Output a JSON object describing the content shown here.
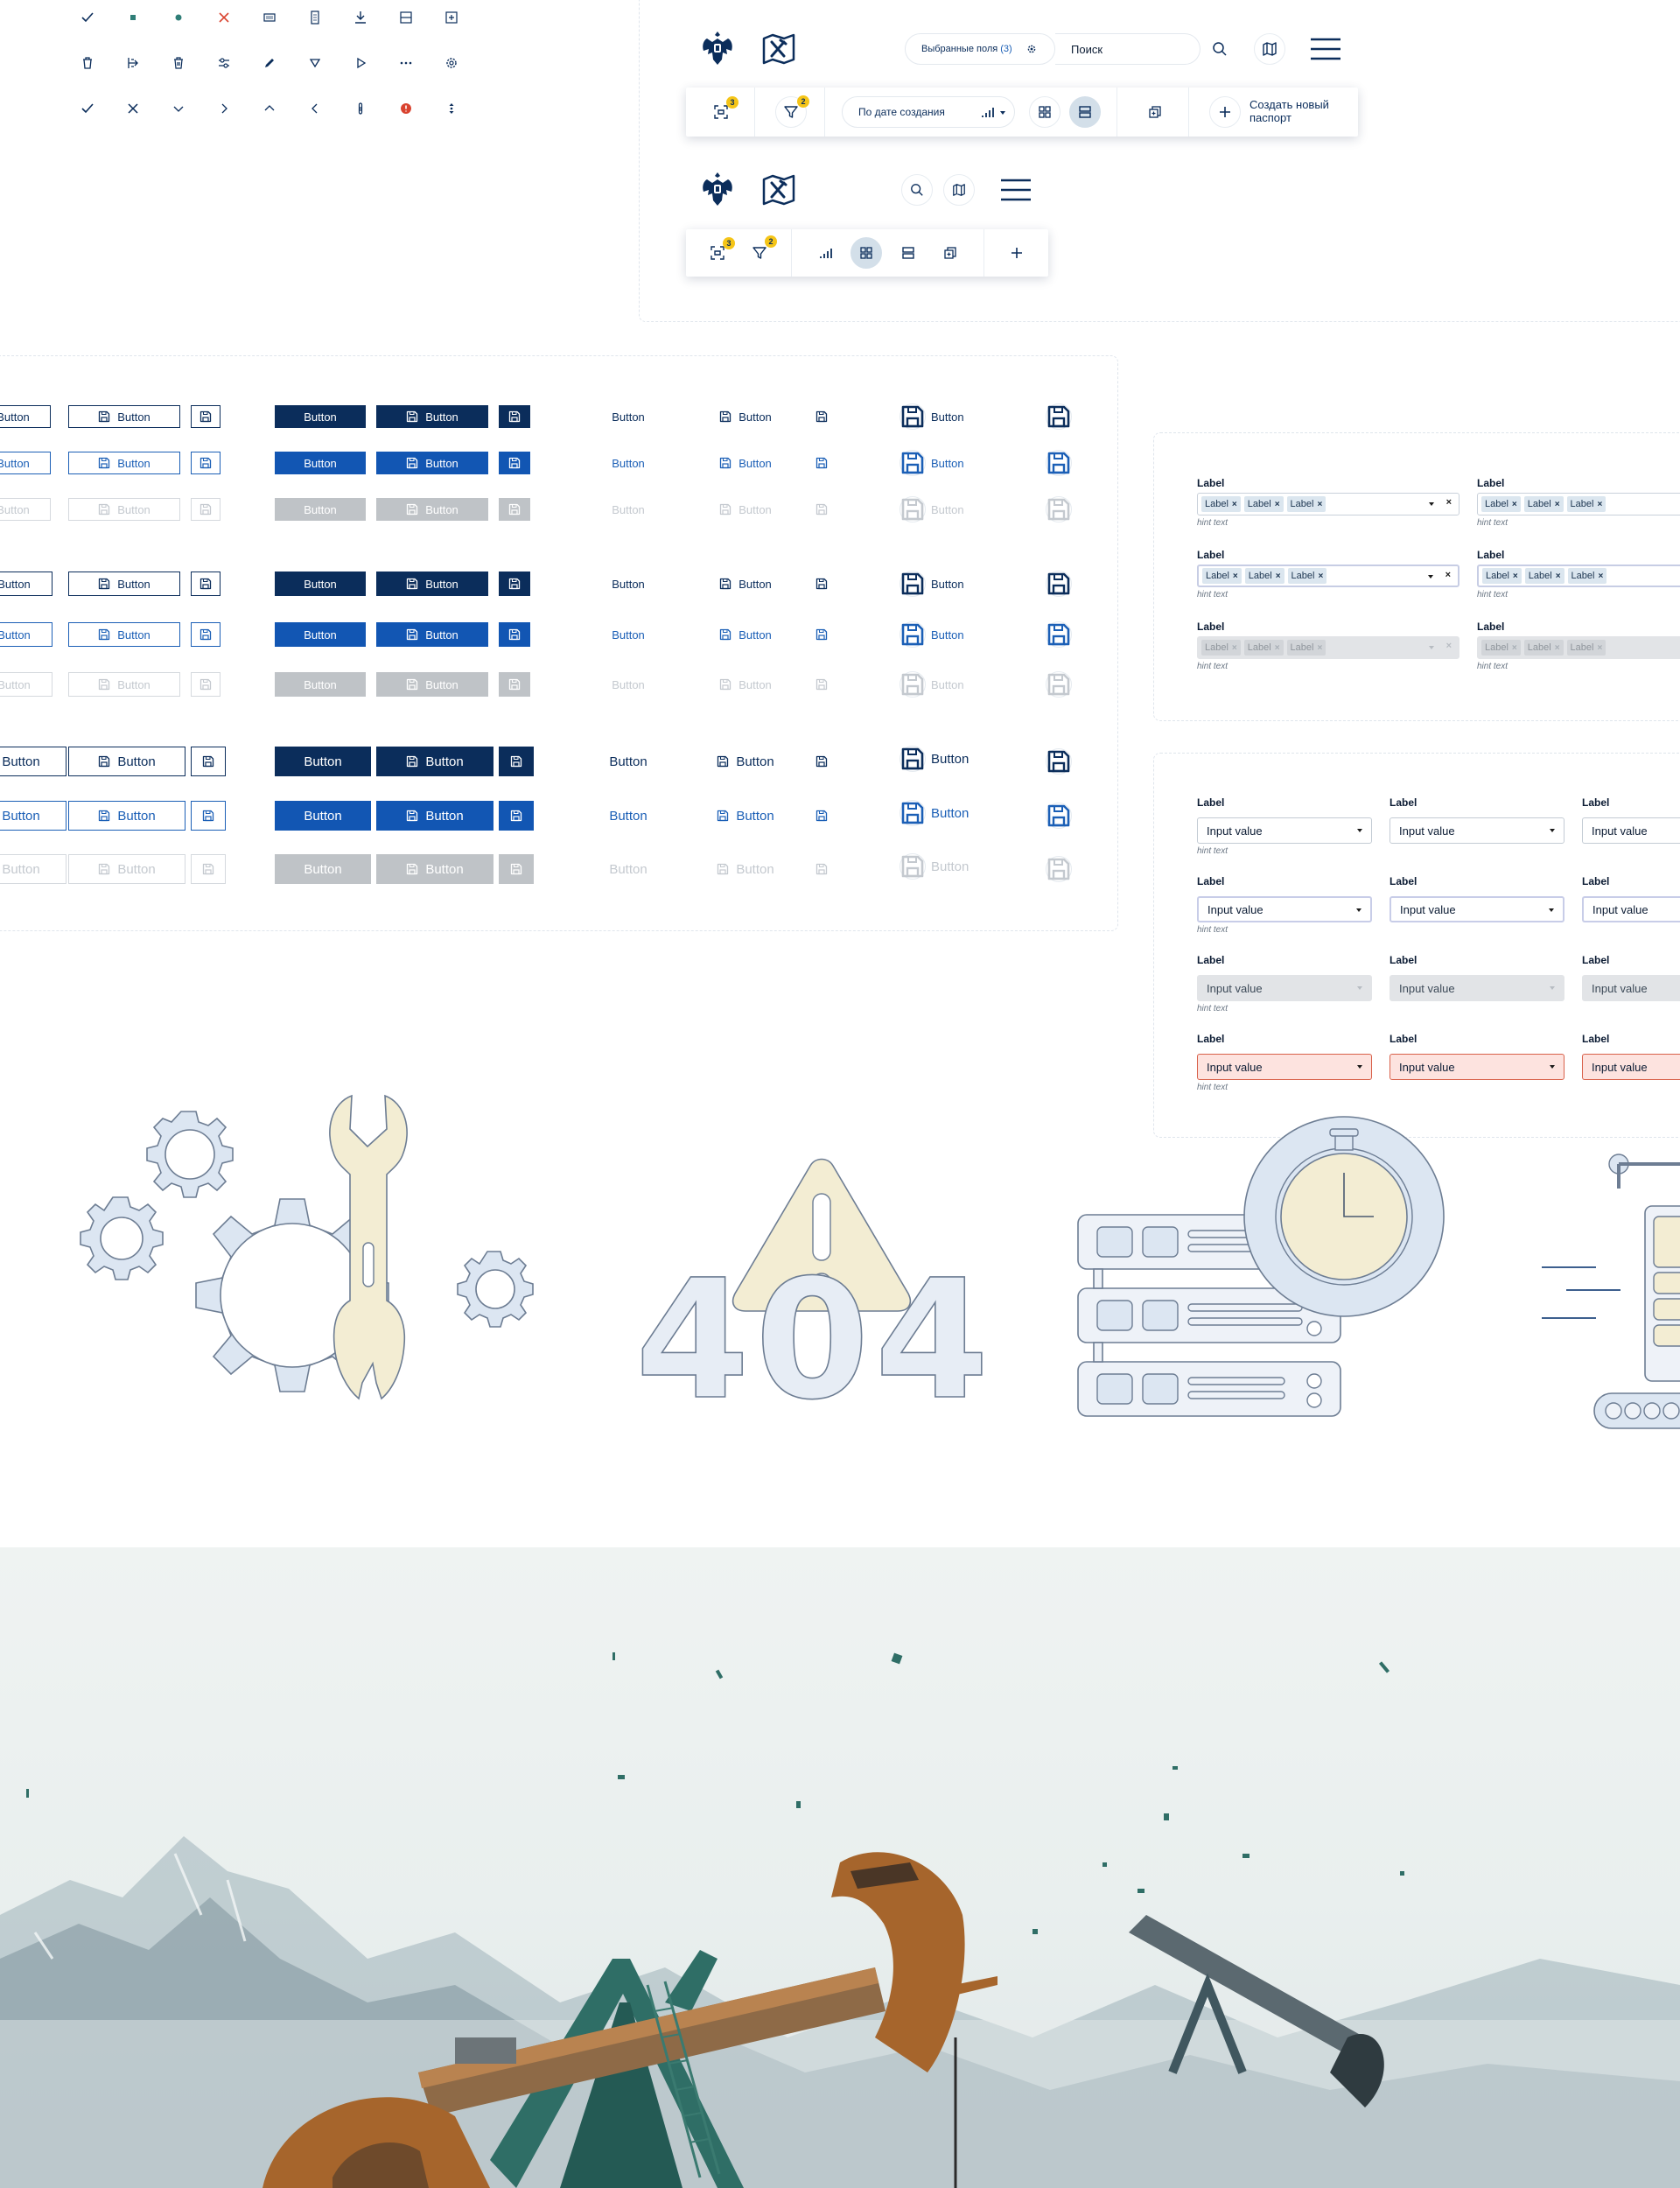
{
  "icons": {
    "row1": [
      "check-icon",
      "square-icon",
      "dot-icon",
      "cross-red-icon",
      "keyboard-icon",
      "document-icon",
      "download-icon",
      "table-row-icon",
      "table-add-icon"
    ],
    "row2": [
      "trash-icon",
      "export-icon",
      "trash-alt-icon",
      "sliders-icon",
      "pencil-icon",
      "triangle-down-icon",
      "play-icon",
      "more-icon",
      "gear-icon"
    ],
    "row3": [
      "check-icon",
      "close-icon",
      "chevron-down-icon",
      "chevron-right-icon",
      "chevron-up-icon",
      "chevron-left-icon",
      "info-icon",
      "error-icon",
      "drag-vertical-icon"
    ]
  },
  "header_wide": {
    "fields_label": "Выбранные поля",
    "fields_count": "(3)",
    "search_placeholder": "Поиск",
    "sort_label": "По дате создания",
    "create_label_line1": "Создать новый",
    "create_label_line2": "паспорт",
    "scan_badge": "3",
    "filter_badge": "2"
  },
  "header_compact": {
    "scan_badge": "3",
    "filter_badge": "2"
  },
  "buttons": {
    "label": "Button"
  },
  "tag_fields": {
    "label": "Label",
    "tag": "Label",
    "hint": "hint text"
  },
  "select_fields": {
    "label": "Label",
    "value": "Input value",
    "hint": "hint text"
  },
  "illustration_404": {
    "text": "404"
  },
  "colors": {
    "navy": "#0b2d5b",
    "blue": "#1256b3",
    "disabled": "#bfc3c7",
    "accent_yellow": "#f5c518",
    "illustration_blue": "#dce6f2",
    "illustration_cream": "#f3edd3",
    "error_bg": "#fde3df"
  }
}
